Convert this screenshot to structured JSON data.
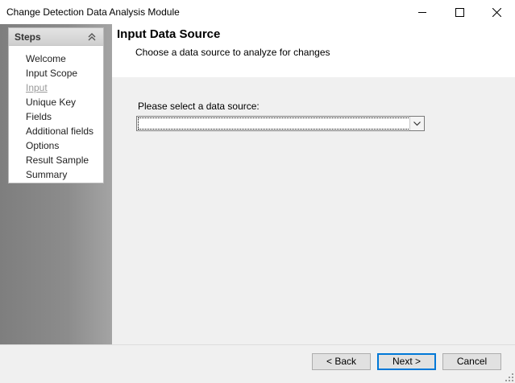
{
  "window": {
    "title": "Change Detection Data Analysis Module",
    "controls": {
      "minimize": "minimize-icon",
      "maximize": "maximize-icon",
      "close": "close-icon"
    }
  },
  "sidebar": {
    "title": "Steps",
    "collapse_icon": "double-chevron-up-icon",
    "current_step": "Input",
    "items": [
      {
        "label": "Welcome"
      },
      {
        "label": "Input Scope"
      },
      {
        "label": "Input"
      },
      {
        "label": "Unique Key"
      },
      {
        "label": "Fields"
      },
      {
        "label": "Additional fields"
      },
      {
        "label": "Options"
      },
      {
        "label": "Result Sample"
      },
      {
        "label": "Summary"
      }
    ]
  },
  "header": {
    "title": "Input Data Source",
    "subtitle": "Choose a data source to analyze for changes"
  },
  "form": {
    "data_source_label": "Please select a data source:",
    "data_source_value": ""
  },
  "footer": {
    "back_label": "< Back",
    "next_label": "Next >",
    "cancel_label": "Cancel"
  },
  "colors": {
    "focus_border": "#0078d7",
    "current_step_text": "#9a9a9a"
  }
}
